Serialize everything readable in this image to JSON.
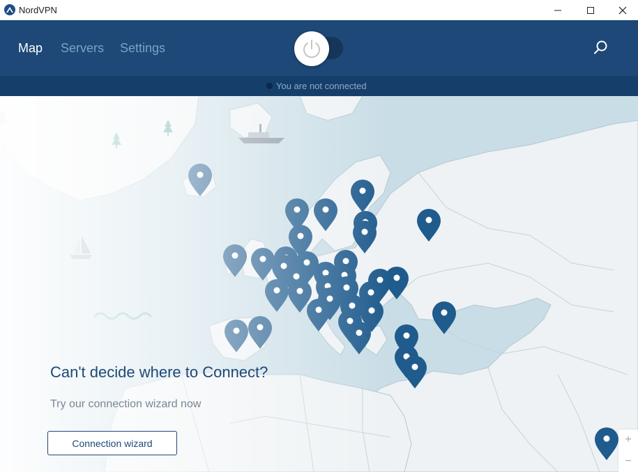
{
  "window": {
    "title": "NordVPN",
    "logo_icon": "nordvpn-logo-icon"
  },
  "nav": {
    "items": [
      {
        "label": "Map",
        "active": true
      },
      {
        "label": "Servers",
        "active": false
      },
      {
        "label": "Settings",
        "active": false
      }
    ]
  },
  "status": {
    "text": "You are not connected",
    "connected": false
  },
  "promo": {
    "title": "Can't decide where to Connect?",
    "subtitle": "Try our connection wizard now",
    "button_label": "Connection wizard"
  },
  "zoom": {
    "in_label": "+",
    "out_label": "−"
  },
  "colors": {
    "header": "#1d4877",
    "status_bar": "#163e6b",
    "sea": "#c9dde6",
    "land": "#eef2f4",
    "pin": "#1f5b8d",
    "accent": "#1d4877"
  },
  "icons": [
    "power-icon",
    "search-icon",
    "location-pin-icon",
    "ship-icon",
    "sailboat-icon",
    "tree-icon",
    "wave-icon"
  ]
}
